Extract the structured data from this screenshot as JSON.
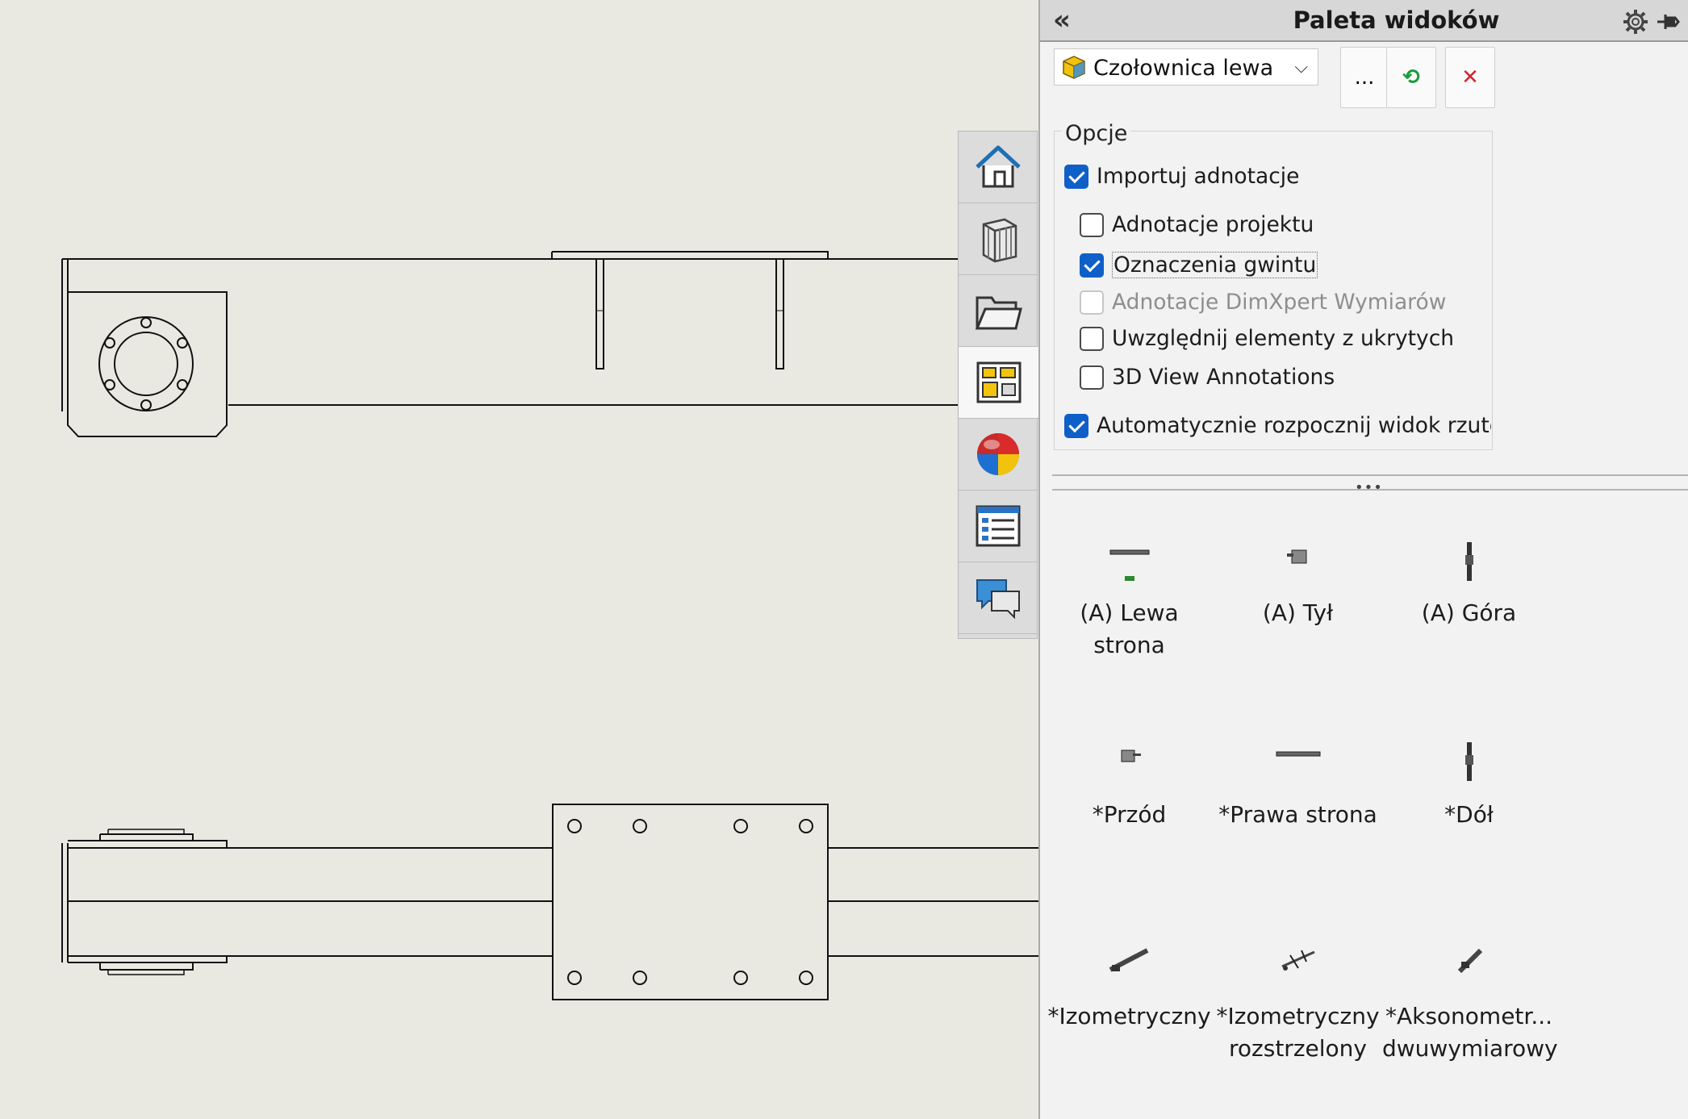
{
  "panel": {
    "title": "Paleta widoków",
    "collapse_icon": "«",
    "source_document": "Czołownica lewa",
    "browse_label": "...",
    "refresh_glyph": "⟲",
    "clear_glyph": "✕",
    "options_legend": "Opcje",
    "options": {
      "import_annotations": {
        "label": "Importuj adnotacje",
        "checked": true
      },
      "design_annotations": {
        "label": "Adnotacje projektu",
        "checked": false
      },
      "thread_callouts": {
        "label": "Oznaczenia gwintu",
        "checked": true
      },
      "dimxpert_annotations": {
        "label": "Adnotacje DimXpert Wymiarów",
        "checked": false,
        "disabled": true
      },
      "include_hidden": {
        "label": "Uwzględnij elementy z ukrytych",
        "checked": false
      },
      "view_3d_annotations": {
        "label": "3D View Annotations",
        "checked": false
      },
      "auto_start_projected": {
        "label": "Automatycznie rozpocznij widok rzutowa",
        "checked": true
      }
    },
    "views": [
      {
        "line1": "(A) Lewa strona",
        "line2": ""
      },
      {
        "line1": "(A) Tył",
        "line2": ""
      },
      {
        "line1": "(A) Góra",
        "line2": ""
      },
      {
        "line1": "*Przód",
        "line2": ""
      },
      {
        "line1": "*Prawa strona",
        "line2": ""
      },
      {
        "line1": "*Dół",
        "line2": ""
      },
      {
        "line1": "*Izometryczny",
        "line2": ""
      },
      {
        "line1": "*Izometryczny",
        "line2": "rozstrzelony"
      },
      {
        "line1": "*Aksonometr...",
        "line2": "dwuwymiarowy"
      }
    ]
  },
  "tabs": [
    "home-icon",
    "design-library-icon",
    "file-explorer-icon",
    "view-palette-icon",
    "appearances-icon",
    "custom-properties-icon",
    "forum-icon"
  ],
  "colors": {
    "canvas": "#e9e9e2",
    "panel": "#f2f2f2",
    "checkbox_on": "#0f5fc9",
    "line": "#111111"
  }
}
